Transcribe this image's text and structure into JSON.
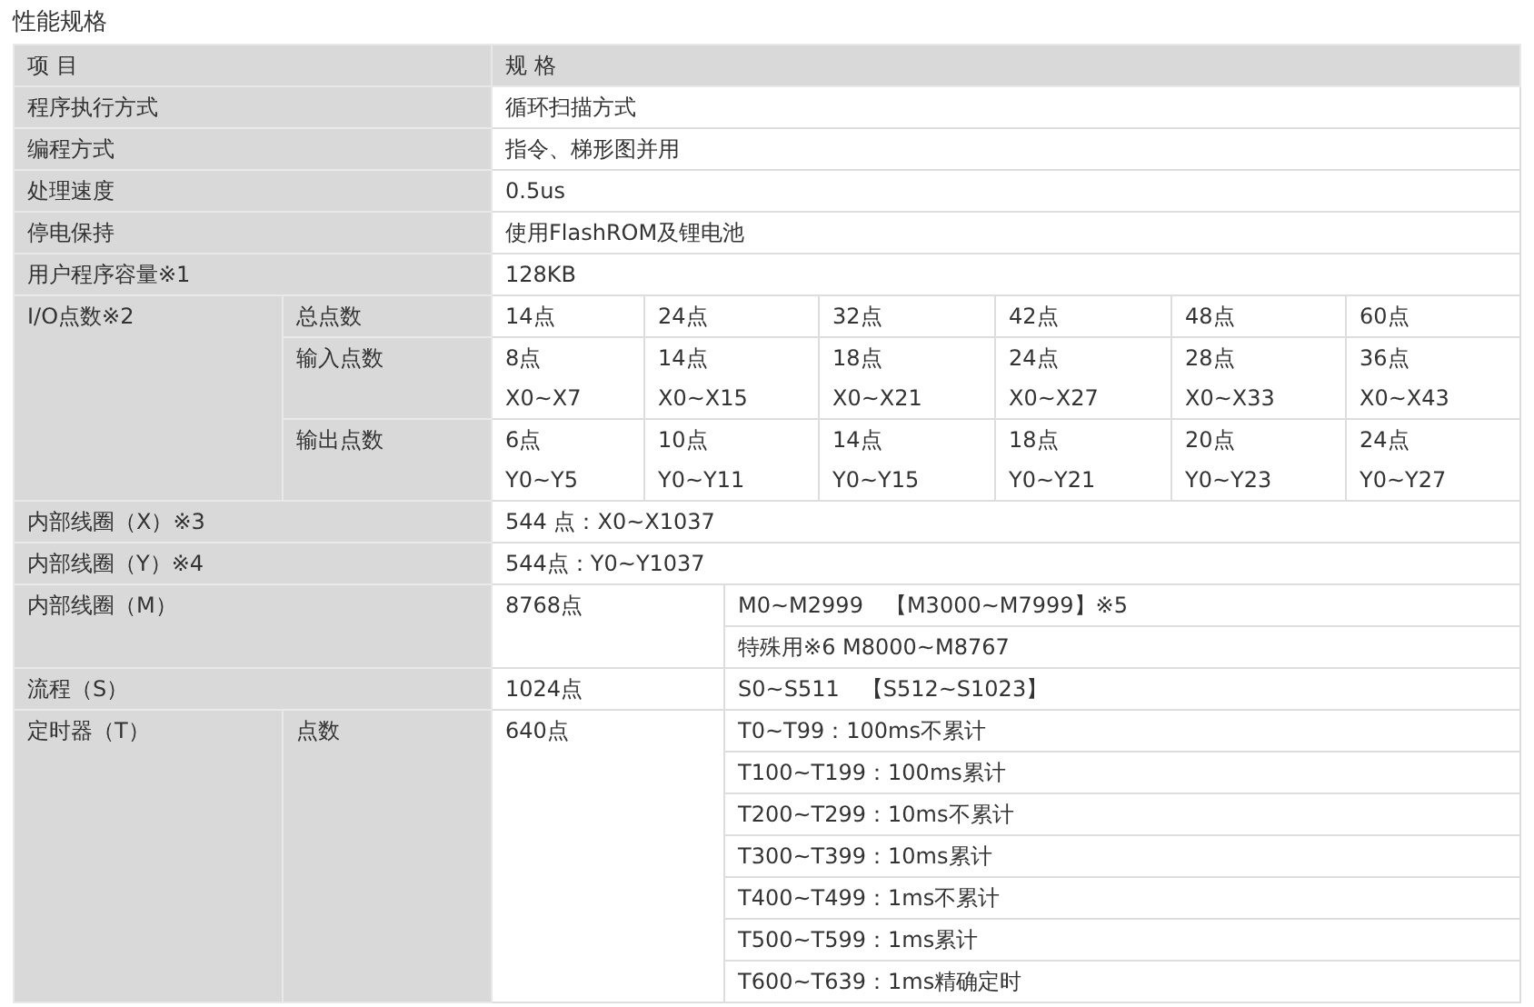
{
  "title": "性能规格",
  "header": [
    "项 目",
    "规 格"
  ],
  "rows": [
    {
      "kind": "simple",
      "label": "程序执行方式",
      "value": "循环扫描方式"
    },
    {
      "kind": "simple",
      "label": "编程方式",
      "value": "指令、梯形图并用"
    },
    {
      "kind": "simple",
      "label": "处理速度",
      "value": "0.5us"
    },
    {
      "kind": "simple",
      "label": "停电保持",
      "value": "使用FlashROM及锂电池"
    },
    {
      "kind": "simple",
      "label": "用户程序容量※1",
      "value": "128KB"
    },
    {
      "kind": "io",
      "label": "I/O点数※2",
      "subrows": [
        {
          "label": "总点数",
          "cells": [
            "14点",
            "24点",
            "32点",
            "42点",
            "48点",
            "60点"
          ]
        },
        {
          "label": "输入点数",
          "cells": [
            "8点\nX0~X7",
            "14点\nX0~X15",
            "18点\nX0~X21",
            "24点\nX0~X27",
            "28点\nX0~X33",
            "36点\nX0~X43"
          ]
        },
        {
          "label": "输出点数",
          "cells": [
            "6点\nY0~Y5",
            "10点\nY0~Y11",
            "14点\nY0~Y15",
            "18点\nY0~Y21",
            "20点\nY0~Y23",
            "24点\nY0~Y27"
          ]
        }
      ]
    },
    {
      "kind": "simple",
      "label": "内部线圈（X）※3",
      "value": "544   点：X0~X1037"
    },
    {
      "kind": "simple",
      "label": "内部线圈（Y）※4",
      "value": "544点：Y0~Y1037"
    },
    {
      "kind": "split",
      "label": "内部线圈（M）",
      "count": "8768点",
      "details": [
        "M0~M2999　【M3000~M7999】※5",
        "特殊用※6  M8000~M8767"
      ]
    },
    {
      "kind": "split",
      "label": "流程（S）",
      "count": "1024点",
      "details": [
        "S0~S511　【S512~S1023】"
      ]
    },
    {
      "kind": "split",
      "label": "定时器（T）",
      "sublabel": "点数",
      "count": "640点",
      "details": [
        "T0~T99：100ms不累计",
        "T100~T199：100ms累计",
        "T200~T299：10ms不累计",
        "T300~T399：10ms累计",
        "T400~T499：1ms不累计",
        "T500~T599：1ms累计",
        "T600~T639：1ms精确定时"
      ]
    }
  ]
}
